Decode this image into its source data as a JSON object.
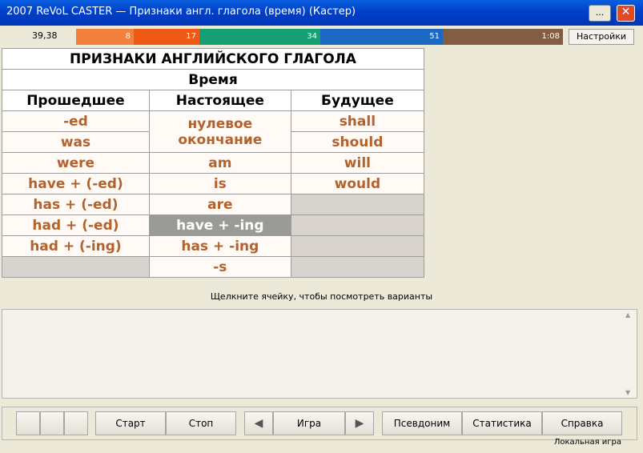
{
  "window": {
    "title": "2007 ReVoL CASTER — Признаки англ. глагола (время) (Кастер)",
    "menu_btn": "...",
    "close_btn": "✕"
  },
  "status": {
    "score": "39,38",
    "bars": [
      "8",
      "17",
      "34",
      "51",
      "1:08"
    ],
    "settings_label": "Настройки"
  },
  "table": {
    "title": "ПРИЗНАКИ АНГЛИЙСКОГО ГЛАГОЛА",
    "subtitle": "Время",
    "columns": [
      "Прошедшее",
      "Настоящее",
      "Будущее"
    ],
    "past": [
      "-ed",
      "was",
      "were",
      "have + (-ed)",
      "has +   (-ed)",
      "had +   (-ed)",
      "had +  (-ing)"
    ],
    "present": [
      "нулевое окончание",
      "am",
      "is",
      "are",
      "have + -ing",
      "has  + -ing",
      "-s"
    ],
    "future": [
      "shall",
      "should",
      "will",
      "would"
    ]
  },
  "hint": "Щелкните ячейку, чтобы посмотреть варианты",
  "toolbar": {
    "start": "Старт",
    "stop": "Стоп",
    "game": "Игра",
    "alias": "Псевдоним",
    "stats": "Статистика",
    "help": "Справка",
    "prev_icon": "triangle-left",
    "next_icon": "triangle-right"
  },
  "footer": "Локальная игра"
}
